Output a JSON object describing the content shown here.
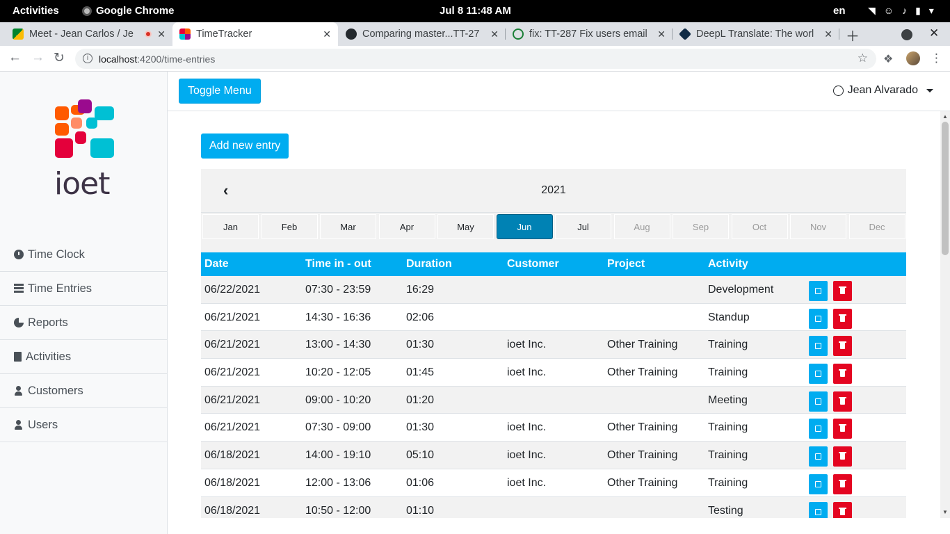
{
  "os": {
    "activities": "Activities",
    "app_name": "Google Chrome",
    "clock": "Jul 8  11:48 AM",
    "language": "en"
  },
  "browser": {
    "tabs": [
      {
        "title": "Meet - Jean Carlos / Je",
        "favicon": "google-meet-icon",
        "recording": true
      },
      {
        "title": "TimeTracker",
        "favicon": "ioet-icon",
        "active": true
      },
      {
        "title": "Comparing master...TT-27",
        "favicon": "github-icon"
      },
      {
        "title": "fix: TT-287 Fix users email",
        "favicon": "github-icon"
      },
      {
        "title": "DeepL Translate: The worl",
        "favicon": "deepl-icon"
      }
    ],
    "url_host": "localhost",
    "url_path": ":4200/time-entries"
  },
  "sidebar": {
    "logo_text": "ioet",
    "items": [
      {
        "label": "Time Clock",
        "icon": "clock-icon"
      },
      {
        "label": "Time Entries",
        "icon": "list-icon"
      },
      {
        "label": "Reports",
        "icon": "pie-chart-icon"
      },
      {
        "label": "Activities",
        "icon": "file-icon"
      },
      {
        "label": "Customers",
        "icon": "user-icon"
      },
      {
        "label": "Users",
        "icon": "user-icon"
      }
    ]
  },
  "header": {
    "toggle_label": "Toggle Menu",
    "user_name": "Jean Alvarado"
  },
  "main": {
    "add_entry_label": "Add new entry",
    "calendar": {
      "year": "2021",
      "selected_month": "Jun",
      "months": [
        "Jan",
        "Feb",
        "Mar",
        "Apr",
        "May",
        "Jun",
        "Jul",
        "Aug",
        "Sep",
        "Oct",
        "Nov",
        "Dec"
      ]
    },
    "table": {
      "columns": [
        "Date",
        "Time in - out",
        "Duration",
        "Customer",
        "Project",
        "Activity"
      ],
      "rows": [
        {
          "date": "06/22/2021",
          "time": "07:30 - 23:59",
          "duration": "16:29",
          "customer": "",
          "project": "",
          "activity": "Development"
        },
        {
          "date": "06/21/2021",
          "time": "14:30 - 16:36",
          "duration": "02:06",
          "customer": "",
          "project": "",
          "activity": "Standup"
        },
        {
          "date": "06/21/2021",
          "time": "13:00 - 14:30",
          "duration": "01:30",
          "customer": "ioet Inc.",
          "project": "Other Training",
          "activity": "Training"
        },
        {
          "date": "06/21/2021",
          "time": "10:20 - 12:05",
          "duration": "01:45",
          "customer": "ioet Inc.",
          "project": "Other Training",
          "activity": "Training"
        },
        {
          "date": "06/21/2021",
          "time": "09:00 - 10:20",
          "duration": "01:20",
          "customer": "",
          "project": "",
          "activity": "Meeting"
        },
        {
          "date": "06/21/2021",
          "time": "07:30 - 09:00",
          "duration": "01:30",
          "customer": "ioet Inc.",
          "project": "Other Training",
          "activity": "Training"
        },
        {
          "date": "06/18/2021",
          "time": "14:00 - 19:10",
          "duration": "05:10",
          "customer": "ioet Inc.",
          "project": "Other Training",
          "activity": "Training"
        },
        {
          "date": "06/18/2021",
          "time": "12:00 - 13:06",
          "duration": "01:06",
          "customer": "ioet Inc.",
          "project": "Other Training",
          "activity": "Training"
        },
        {
          "date": "06/18/2021",
          "time": "10:50 - 12:00",
          "duration": "01:10",
          "customer": "",
          "project": "",
          "activity": "Testing"
        }
      ]
    }
  },
  "colors": {
    "primary": "#00acf0",
    "danger": "#e40521",
    "selected_month": "#0082b4"
  }
}
